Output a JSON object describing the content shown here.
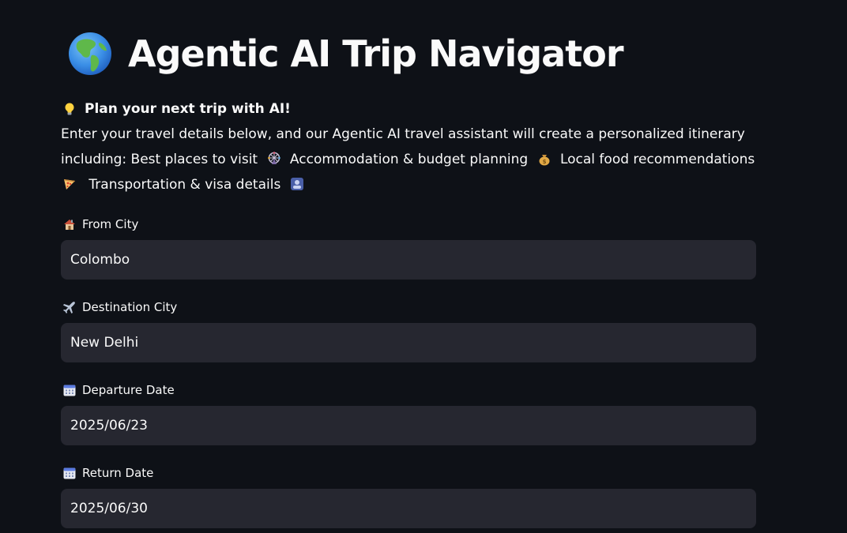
{
  "app": {
    "title": "Agentic AI Trip Navigator",
    "title_icon": "globe-icon"
  },
  "intro": {
    "headline": "Plan your next trip with AI!",
    "headline_icon": "lightbulb-icon",
    "line1": "Enter your travel details below, and our Agentic AI travel assistant will create a personalized itinerary",
    "line2_a": "including: Best places to visit",
    "line2_b": "Accommodation & budget planning",
    "line2_c": "Local food recommendations",
    "line3_a": "Transportation & visa details",
    "icons": [
      "ferris-wheel-icon",
      "money-bag-icon",
      "pizza-icon",
      "passport-control-icon"
    ]
  },
  "form": {
    "from_city": {
      "label": "From City",
      "icon": "house-icon",
      "value": "Colombo"
    },
    "destination_city": {
      "label": "Destination City",
      "icon": "airplane-icon",
      "value": "New Delhi"
    },
    "departure_date": {
      "label": "Departure Date",
      "icon": "calendar-icon",
      "value": "2025/06/23"
    },
    "return_date": {
      "label": "Return Date",
      "icon": "calendar-icon",
      "value": "2025/06/30"
    }
  },
  "colors": {
    "background": "#0e1117",
    "input_background": "#262730",
    "text": "#fafafa"
  }
}
